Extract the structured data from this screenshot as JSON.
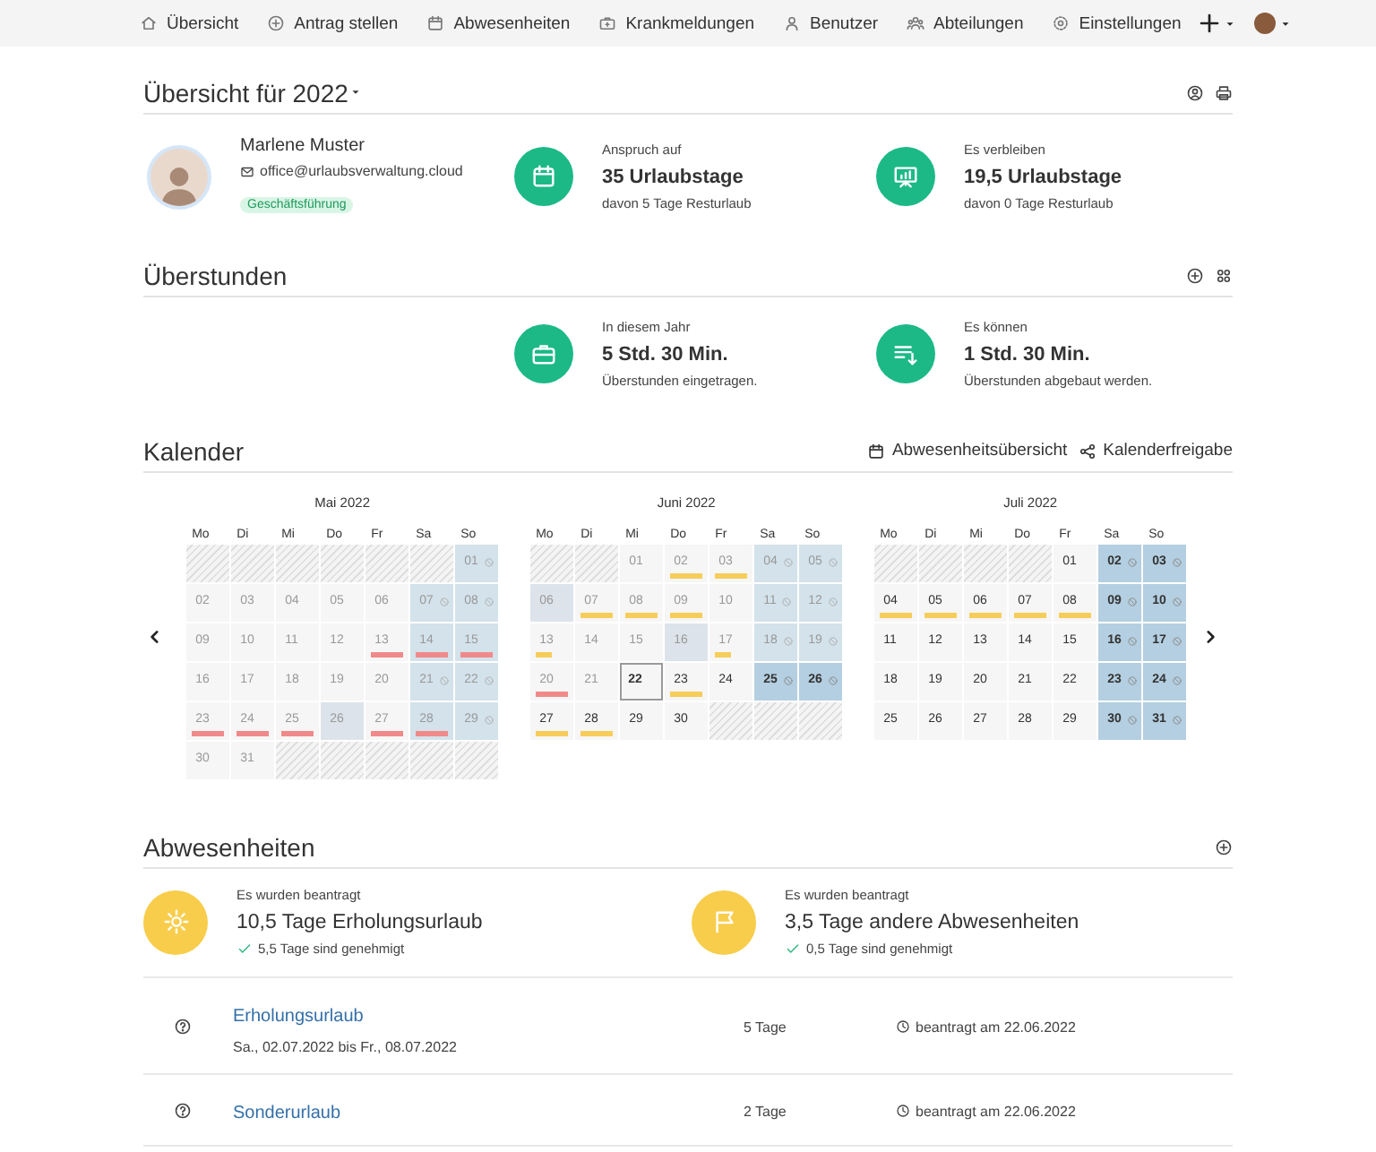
{
  "nav": {
    "items": [
      {
        "kind": "home",
        "label": "Übersicht"
      },
      {
        "kind": "plus-circle",
        "label": "Antrag stellen"
      },
      {
        "kind": "calendar",
        "label": "Abwesenheiten"
      },
      {
        "kind": "medkit",
        "label": "Krankmeldungen"
      },
      {
        "kind": "user",
        "label": "Benutzer"
      },
      {
        "kind": "users",
        "label": "Abteilungen"
      },
      {
        "kind": "gear",
        "label": "Einstellungen"
      }
    ]
  },
  "overview": {
    "title": "Übersicht für 2022",
    "profile": {
      "name": "Marlene Muster",
      "email": "office@urlaubsverwaltung.cloud",
      "tag": "Geschäftsführung"
    },
    "stats": [
      {
        "kind": "calendar",
        "label": "Anspruch auf",
        "value": "35 Urlaubstage",
        "note": "davon 5 Tage Resturlaub"
      },
      {
        "kind": "presentation",
        "label": "Es verbleiben",
        "value": "19,5 Urlaubstage",
        "note": "davon 0 Tage Resturlaub"
      }
    ]
  },
  "overtime": {
    "title": "Überstunden",
    "stats": [
      {
        "kind": "briefcase",
        "label": "In diesem Jahr",
        "value": "5 Std. 30 Min.",
        "note": "Überstunden eingetragen."
      },
      {
        "kind": "list-down",
        "label": "Es können",
        "value": "1 Std. 30 Min.",
        "note": "Überstunden abgebaut werden."
      }
    ]
  },
  "calendar": {
    "title": "Kalender",
    "links": [
      {
        "kind": "calendar",
        "label": "Abwesenheitsübersicht"
      },
      {
        "kind": "share",
        "label": "Kalenderfreigabe"
      }
    ],
    "months": [
      {
        "title": "Mai 2022",
        "weekdays": [
          "Mo",
          "Di",
          "Mi",
          "Do",
          "Fr",
          "Sa",
          "So"
        ],
        "days": [
          {
            "kind": "blank"
          },
          {
            "kind": "blank"
          },
          {
            "kind": "blank"
          },
          {
            "kind": "blank"
          },
          {
            "kind": "blank"
          },
          {
            "kind": "blank"
          },
          {
            "kind": "weekend",
            "day": "01",
            "past": true,
            "blocked": true,
            "today": false
          },
          {
            "kind": "day",
            "day": "02",
            "past": true,
            "blocked": false,
            "today": false
          },
          {
            "kind": "day",
            "day": "03",
            "past": true,
            "blocked": false,
            "today": false
          },
          {
            "kind": "day",
            "day": "04",
            "past": true,
            "blocked": false,
            "today": false
          },
          {
            "kind": "day",
            "day": "05",
            "past": true,
            "blocked": false,
            "today": false
          },
          {
            "kind": "day",
            "day": "06",
            "past": true,
            "blocked": false,
            "today": false
          },
          {
            "kind": "weekend",
            "day": "07",
            "past": true,
            "blocked": true,
            "today": false
          },
          {
            "kind": "weekend",
            "day": "08",
            "past": true,
            "blocked": true,
            "today": false
          },
          {
            "kind": "day",
            "day": "09",
            "past": true,
            "blocked": false,
            "today": false
          },
          {
            "kind": "day",
            "day": "10",
            "past": true,
            "blocked": false,
            "today": false
          },
          {
            "kind": "day",
            "day": "11",
            "past": true,
            "blocked": false,
            "today": false
          },
          {
            "kind": "day",
            "day": "12",
            "past": true,
            "blocked": false,
            "today": false
          },
          {
            "kind": "day",
            "day": "13",
            "past": true,
            "blocked": false,
            "today": false,
            "color": "#f08a8a",
            "half": false
          },
          {
            "kind": "weekend",
            "day": "14",
            "past": true,
            "blocked": false,
            "today": false,
            "color": "#f08a8a",
            "half": false
          },
          {
            "kind": "weekend",
            "day": "15",
            "past": true,
            "blocked": false,
            "today": false,
            "color": "#f08a8a",
            "half": false
          },
          {
            "kind": "day",
            "day": "16",
            "past": true,
            "blocked": false,
            "today": false
          },
          {
            "kind": "day",
            "day": "17",
            "past": true,
            "blocked": false,
            "today": false
          },
          {
            "kind": "day",
            "day": "18",
            "past": true,
            "blocked": false,
            "today": false
          },
          {
            "kind": "day",
            "day": "19",
            "past": true,
            "blocked": false,
            "today": false
          },
          {
            "kind": "day",
            "day": "20",
            "past": true,
            "blocked": false,
            "today": false
          },
          {
            "kind": "weekend",
            "day": "21",
            "past": true,
            "blocked": true,
            "today": false
          },
          {
            "kind": "weekend",
            "day": "22",
            "past": true,
            "blocked": true,
            "today": false
          },
          {
            "kind": "day",
            "day": "23",
            "past": true,
            "blocked": false,
            "today": false,
            "color": "#f08a8a",
            "half": false
          },
          {
            "kind": "day",
            "day": "24",
            "past": true,
            "blocked": false,
            "today": false,
            "color": "#f08a8a",
            "half": false
          },
          {
            "kind": "day",
            "day": "25",
            "past": true,
            "blocked": false,
            "today": false,
            "color": "#f08a8a",
            "half": false
          },
          {
            "kind": "holiday",
            "day": "26",
            "past": true,
            "blocked": false,
            "today": false
          },
          {
            "kind": "day",
            "day": "27",
            "past": true,
            "blocked": false,
            "today": false,
            "color": "#f08a8a",
            "half": false
          },
          {
            "kind": "weekend",
            "day": "28",
            "past": true,
            "blocked": false,
            "today": false,
            "color": "#f08a8a",
            "half": false
          },
          {
            "kind": "weekend",
            "day": "29",
            "past": true,
            "blocked": true,
            "today": false
          },
          {
            "kind": "day",
            "day": "30",
            "past": true,
            "blocked": false,
            "today": false
          },
          {
            "kind": "day",
            "day": "31",
            "past": true,
            "blocked": false,
            "today": false
          }
        ]
      },
      {
        "title": "Juni 2022",
        "weekdays": [
          "Mo",
          "Di",
          "Mi",
          "Do",
          "Fr",
          "Sa",
          "So"
        ],
        "days": [
          {
            "kind": "blank"
          },
          {
            "kind": "blank"
          },
          {
            "kind": "day",
            "day": "01",
            "past": true,
            "blocked": false,
            "today": false
          },
          {
            "kind": "day",
            "day": "02",
            "past": true,
            "blocked": false,
            "today": false,
            "color": "#f6cd5a",
            "half": false
          },
          {
            "kind": "day",
            "day": "03",
            "past": true,
            "blocked": false,
            "today": false,
            "color": "#f6cd5a",
            "half": false
          },
          {
            "kind": "weekend",
            "day": "04",
            "past": true,
            "blocked": true,
            "today": false
          },
          {
            "kind": "weekend",
            "day": "05",
            "past": true,
            "blocked": true,
            "today": false
          },
          {
            "kind": "holiday",
            "day": "06",
            "past": true,
            "blocked": false,
            "today": false
          },
          {
            "kind": "day",
            "day": "07",
            "past": true,
            "blocked": false,
            "today": false,
            "color": "#f6cd5a",
            "half": false
          },
          {
            "kind": "day",
            "day": "08",
            "past": true,
            "blocked": false,
            "today": false,
            "color": "#f6cd5a",
            "half": false
          },
          {
            "kind": "day",
            "day": "09",
            "past": true,
            "blocked": false,
            "today": false,
            "color": "#f6cd5a",
            "half": false
          },
          {
            "kind": "day",
            "day": "10",
            "past": true,
            "blocked": false,
            "today": false
          },
          {
            "kind": "weekend",
            "day": "11",
            "past": true,
            "blocked": true,
            "today": false
          },
          {
            "kind": "weekend",
            "day": "12",
            "past": true,
            "blocked": true,
            "today": false
          },
          {
            "kind": "day",
            "day": "13",
            "past": true,
            "blocked": false,
            "today": false,
            "color": "#f6cd5a",
            "half": true
          },
          {
            "kind": "day",
            "day": "14",
            "past": true,
            "blocked": false,
            "today": false
          },
          {
            "kind": "day",
            "day": "15",
            "past": true,
            "blocked": false,
            "today": false
          },
          {
            "kind": "holiday",
            "day": "16",
            "past": true,
            "blocked": false,
            "today": false
          },
          {
            "kind": "day",
            "day": "17",
            "past": true,
            "blocked": false,
            "today": false,
            "color": "#f6cd5a",
            "half": true
          },
          {
            "kind": "weekend",
            "day": "18",
            "past": true,
            "blocked": true,
            "today": false
          },
          {
            "kind": "weekend",
            "day": "19",
            "past": true,
            "blocked": true,
            "today": false
          },
          {
            "kind": "day",
            "day": "20",
            "past": true,
            "blocked": false,
            "today": false,
            "color": "#f08a8a",
            "half": false
          },
          {
            "kind": "day",
            "day": "21",
            "past": true,
            "blocked": false,
            "today": false
          },
          {
            "kind": "day",
            "day": "22",
            "past": false,
            "blocked": false,
            "today": true
          },
          {
            "kind": "day",
            "day": "23",
            "past": false,
            "blocked": false,
            "today": false,
            "color": "#f6cd5a",
            "half": false
          },
          {
            "kind": "day",
            "day": "24",
            "past": false,
            "blocked": false,
            "today": false
          },
          {
            "kind": "weekend",
            "day": "25",
            "past": false,
            "blocked": true,
            "today": false
          },
          {
            "kind": "weekend",
            "day": "26",
            "past": false,
            "blocked": true,
            "today": false
          },
          {
            "kind": "day",
            "day": "27",
            "past": false,
            "blocked": false,
            "today": false,
            "color": "#f6cd5a",
            "half": false
          },
          {
            "kind": "day",
            "day": "28",
            "past": false,
            "blocked": false,
            "today": false,
            "color": "#f6cd5a",
            "half": false
          },
          {
            "kind": "day",
            "day": "29",
            "past": false,
            "blocked": false,
            "today": false
          },
          {
            "kind": "day",
            "day": "30",
            "past": false,
            "blocked": false,
            "today": false
          }
        ]
      },
      {
        "title": "Juli 2022",
        "weekdays": [
          "Mo",
          "Di",
          "Mi",
          "Do",
          "Fr",
          "Sa",
          "So"
        ],
        "days": [
          {
            "kind": "blank"
          },
          {
            "kind": "blank"
          },
          {
            "kind": "blank"
          },
          {
            "kind": "blank"
          },
          {
            "kind": "day",
            "day": "01",
            "past": false,
            "blocked": false,
            "today": false
          },
          {
            "kind": "weekend",
            "day": "02",
            "past": false,
            "blocked": true,
            "today": false
          },
          {
            "kind": "weekend",
            "day": "03",
            "past": false,
            "blocked": true,
            "today": false
          },
          {
            "kind": "day",
            "day": "04",
            "past": false,
            "blocked": false,
            "today": false,
            "color": "#f6cd5a",
            "half": false
          },
          {
            "kind": "day",
            "day": "05",
            "past": false,
            "blocked": false,
            "today": false,
            "color": "#f6cd5a",
            "half": false
          },
          {
            "kind": "day",
            "day": "06",
            "past": false,
            "blocked": false,
            "today": false,
            "color": "#f6cd5a",
            "half": false
          },
          {
            "kind": "day",
            "day": "07",
            "past": false,
            "blocked": false,
            "today": false,
            "color": "#f6cd5a",
            "half": false
          },
          {
            "kind": "day",
            "day": "08",
            "past": false,
            "blocked": false,
            "today": false,
            "color": "#f6cd5a",
            "half": false
          },
          {
            "kind": "weekend",
            "day": "09",
            "past": false,
            "blocked": true,
            "today": false
          },
          {
            "kind": "weekend",
            "day": "10",
            "past": false,
            "blocked": true,
            "today": false
          },
          {
            "kind": "day",
            "day": "11",
            "past": false,
            "blocked": false,
            "today": false
          },
          {
            "kind": "day",
            "day": "12",
            "past": false,
            "blocked": false,
            "today": false
          },
          {
            "kind": "day",
            "day": "13",
            "past": false,
            "blocked": false,
            "today": false
          },
          {
            "kind": "day",
            "day": "14",
            "past": false,
            "blocked": false,
            "today": false
          },
          {
            "kind": "day",
            "day": "15",
            "past": false,
            "blocked": false,
            "today": false
          },
          {
            "kind": "weekend",
            "day": "16",
            "past": false,
            "blocked": true,
            "today": false
          },
          {
            "kind": "weekend",
            "day": "17",
            "past": false,
            "blocked": true,
            "today": false
          },
          {
            "kind": "day",
            "day": "18",
            "past": false,
            "blocked": false,
            "today": false
          },
          {
            "kind": "day",
            "day": "19",
            "past": false,
            "blocked": false,
            "today": false
          },
          {
            "kind": "day",
            "day": "20",
            "past": false,
            "blocked": false,
            "today": false
          },
          {
            "kind": "day",
            "day": "21",
            "past": false,
            "blocked": false,
            "today": false
          },
          {
            "kind": "day",
            "day": "22",
            "past": false,
            "blocked": false,
            "today": false
          },
          {
            "kind": "weekend",
            "day": "23",
            "past": false,
            "blocked": true,
            "today": false
          },
          {
            "kind": "weekend",
            "day": "24",
            "past": false,
            "blocked": true,
            "today": false
          },
          {
            "kind": "day",
            "day": "25",
            "past": false,
            "blocked": false,
            "today": false
          },
          {
            "kind": "day",
            "day": "26",
            "past": false,
            "blocked": false,
            "today": false
          },
          {
            "kind": "day",
            "day": "27",
            "past": false,
            "blocked": false,
            "today": false
          },
          {
            "kind": "day",
            "day": "28",
            "past": false,
            "blocked": false,
            "today": false
          },
          {
            "kind": "day",
            "day": "29",
            "past": false,
            "blocked": false,
            "today": false
          },
          {
            "kind": "weekend",
            "day": "30",
            "past": false,
            "blocked": true,
            "today": false
          },
          {
            "kind": "weekend",
            "day": "31",
            "past": false,
            "blocked": true,
            "today": false
          }
        ]
      }
    ]
  },
  "absences": {
    "title": "Abwesenheiten",
    "summaries": [
      {
        "kind": "sun",
        "label": "Es wurden beantragt",
        "value": "10,5 Tage Erholungsurlaub",
        "approved": "5,5 Tage sind genehmigt"
      },
      {
        "kind": "flag",
        "label": "Es wurden beantragt",
        "value": "3,5 Tage andere Abwesenheiten",
        "approved": "0,5 Tage sind genehmigt"
      }
    ],
    "rows": [
      {
        "title": "Erholungsurlaub",
        "dates": "Sa., 02.07.2022 bis Fr., 08.07.2022",
        "duration": "5 Tage",
        "requested": "beantragt am 22.06.2022"
      },
      {
        "title": "Sonderurlaub",
        "duration": "2 Tage",
        "requested": "beantragt am 22.06.2022"
      }
    ]
  }
}
